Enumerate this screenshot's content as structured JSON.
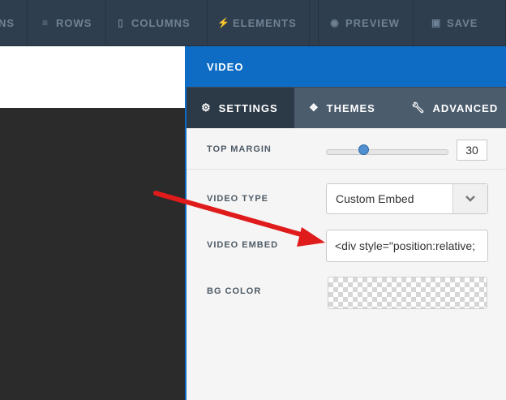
{
  "toolbar": {
    "items": [
      {
        "label": "NS"
      },
      {
        "label": "ROWS"
      },
      {
        "label": "COLUMNS"
      },
      {
        "label": "ELEMENTS"
      },
      {
        "label": "PREVIEW"
      },
      {
        "label": "SAVE"
      }
    ]
  },
  "panel": {
    "title": "VIDEO",
    "tabs": [
      {
        "label": "SETTINGS",
        "active": true
      },
      {
        "label": "THEMES"
      },
      {
        "label": "ADVANCED"
      }
    ],
    "fields": {
      "top_margin": {
        "label": "TOP MARGIN",
        "value": "30",
        "slider_fraction": 0.3
      },
      "video_type": {
        "label": "VIDEO TYPE",
        "value": "Custom Embed"
      },
      "video_embed": {
        "label": "VIDEO EMBED",
        "value": "<div style=\"position:relative;"
      },
      "bg_color": {
        "label": "BG COLOR",
        "value": "transparent"
      }
    }
  },
  "colors": {
    "toolbar_bg": "#2f3e4e",
    "panel_header": "#0e6cc4",
    "tabs_bg": "#4b5c6d",
    "tab_active": "#2c3a48",
    "annotation_arrow": "#e01b1b"
  }
}
